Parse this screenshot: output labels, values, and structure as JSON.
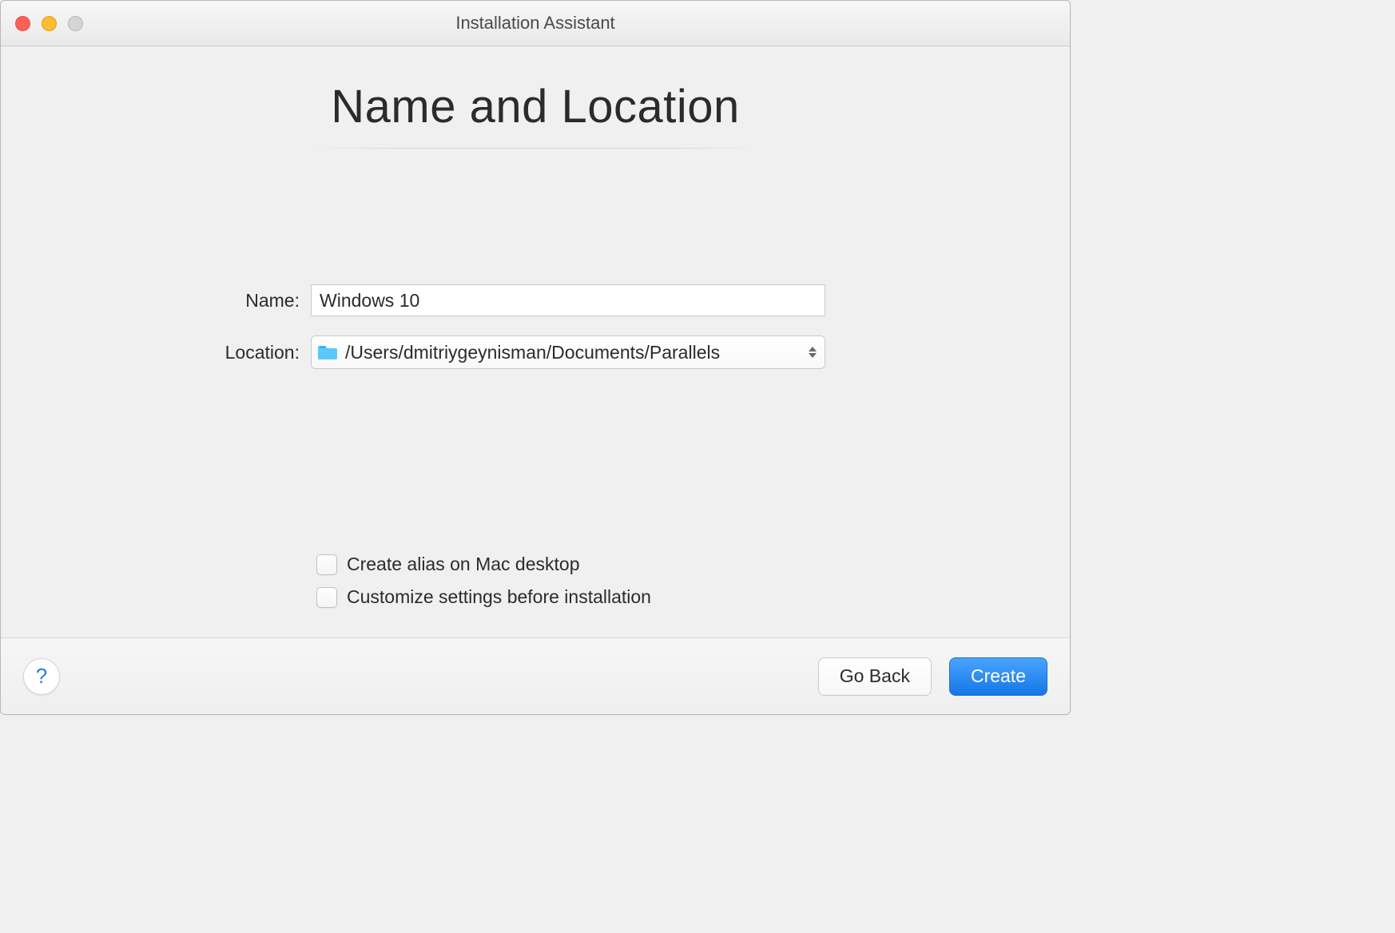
{
  "titlebar": {
    "title": "Installation Assistant"
  },
  "heading": "Name and Location",
  "form": {
    "name_label": "Name:",
    "name_value": "Windows 10",
    "location_label": "Location:",
    "location_value": "/Users/dmitriygeynisman/Documents/Parallels"
  },
  "options": {
    "create_alias": "Create alias on Mac desktop",
    "customize": "Customize settings before installation"
  },
  "footer": {
    "help": "?",
    "go_back": "Go Back",
    "create": "Create"
  },
  "colors": {
    "primary": "#1477e6",
    "folder": "#5ac8fa"
  }
}
